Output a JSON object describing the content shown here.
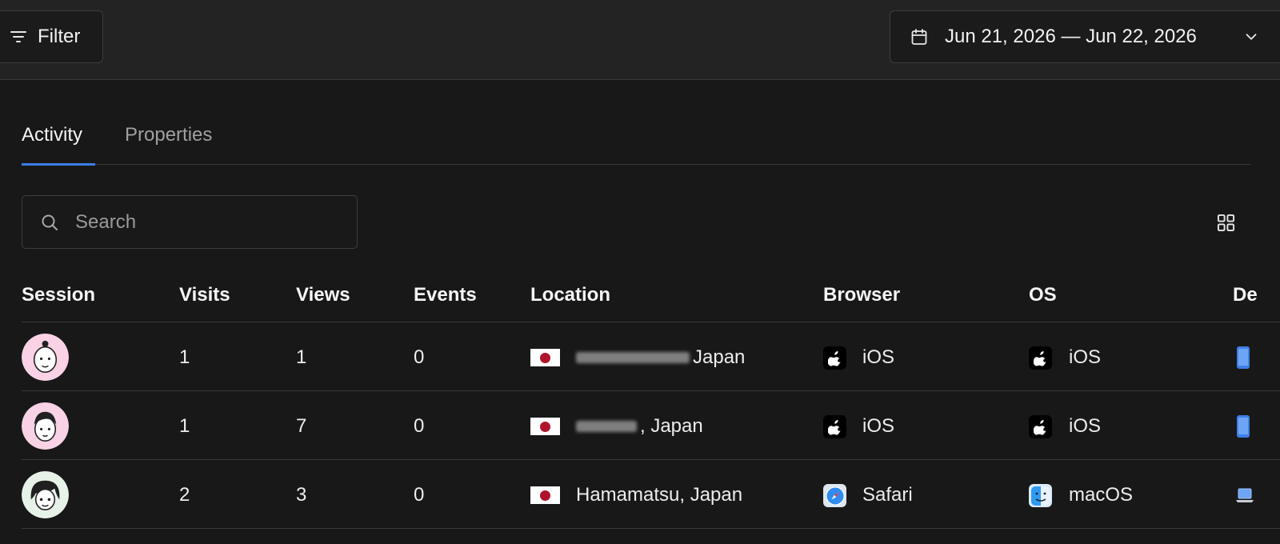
{
  "toolbar": {
    "filter_label": "Filter",
    "date_range": "Jun 21, 2026 — Jun 22, 2026"
  },
  "tabs": [
    {
      "label": "Activity",
      "active": true
    },
    {
      "label": "Properties",
      "active": false
    }
  ],
  "search": {
    "placeholder": "Search",
    "value": ""
  },
  "table": {
    "columns": [
      "Session",
      "Visits",
      "Views",
      "Events",
      "Location",
      "Browser",
      "OS",
      "De"
    ],
    "rows": [
      {
        "visits": "1",
        "views": "1",
        "events": "0",
        "location_visible": "Japan",
        "location_prefix": "",
        "browser": "iOS",
        "browser_icon": "apple-icon",
        "os": "iOS",
        "os_icon": "apple-icon",
        "device_icon": "mobile-icon"
      },
      {
        "visits": "1",
        "views": "7",
        "events": "0",
        "location_visible": ", Japan",
        "location_prefix": "",
        "browser": "iOS",
        "browser_icon": "apple-icon",
        "os": "iOS",
        "os_icon": "apple-icon",
        "device_icon": "mobile-icon"
      },
      {
        "visits": "2",
        "views": "3",
        "events": "0",
        "location_visible": "Hamamatsu, Japan",
        "location_prefix": "",
        "browser": "Safari",
        "browser_icon": "safari-icon",
        "os": "macOS",
        "os_icon": "finder-icon",
        "device_icon": "laptop-icon"
      }
    ]
  },
  "colors": {
    "accent": "#3b7de8",
    "background": "#181818",
    "topbar": "#232323",
    "flag_red": "#b0142c",
    "avatar_pink": "#f9d2e6",
    "avatar_mint": "#e6f2e7"
  }
}
